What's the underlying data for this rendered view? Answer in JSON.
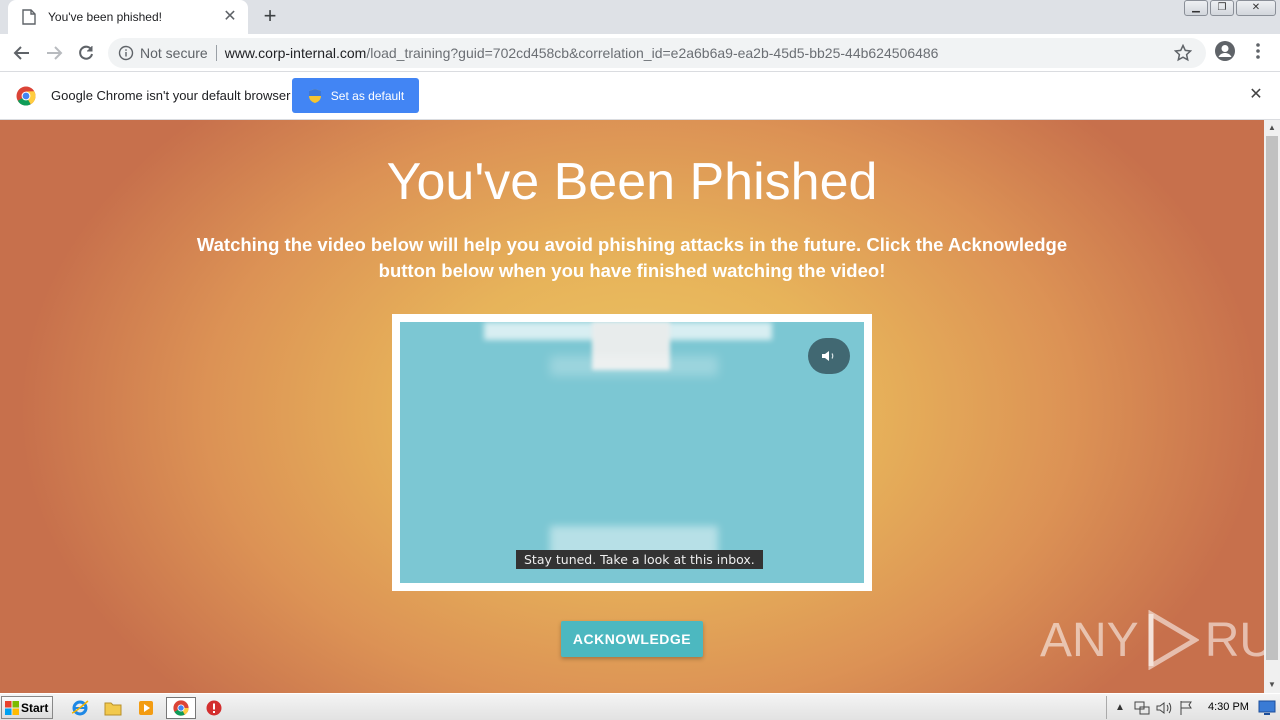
{
  "browser": {
    "tab": {
      "title": "You've been phished!",
      "close_label": "✕"
    },
    "new_tab_label": "+",
    "window_controls": {
      "minimize": "▁",
      "restore": "❐",
      "close": "✕"
    },
    "address": {
      "security_label": "Not secure",
      "host": "www.corp-internal.com",
      "path": "/load_training?guid=702cd458cb&correlation_id=e2a6b6a9-ea2b-45d5-bb25-44b624506486"
    },
    "infobar": {
      "message": "Google Chrome isn't your default browser",
      "button_label": "Set as default",
      "close_label": "✕"
    }
  },
  "page": {
    "headline": "You've Been Phished",
    "subtext": "Watching the video below will help you avoid phishing attacks in the future. Click the Acknowledge button below when you have finished watching the video!",
    "video": {
      "caption": "Stay tuned. Take a look at this inbox.",
      "mute_icon": "speaker-icon"
    },
    "acknowledge_label": "ACKNOWLEDGE",
    "watermark": {
      "left": "ANY",
      "right": "RUN"
    }
  },
  "taskbar": {
    "start_label": "Start",
    "clock": "4:30 PM"
  },
  "colors": {
    "accent_blue": "#4285f4",
    "teal_button": "#4cb8c0",
    "video_bg": "#7cc7d3"
  }
}
